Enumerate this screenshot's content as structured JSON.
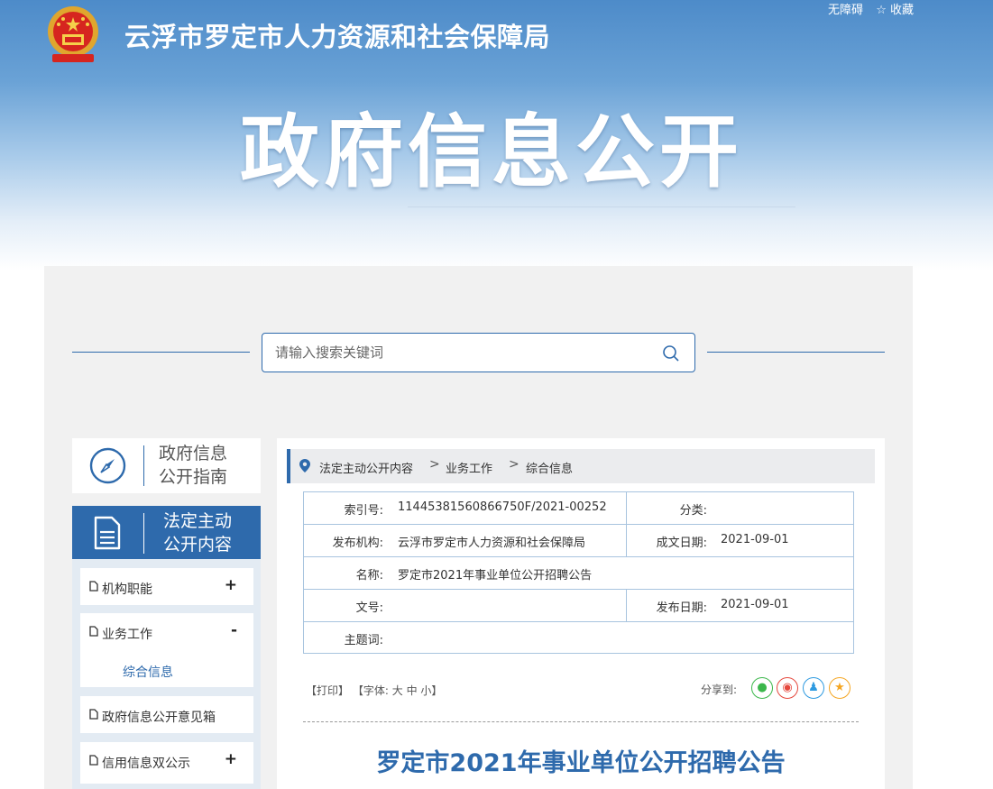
{
  "site": {
    "name": "云浮市罗定市人力资源和社会保障局",
    "top_links": [
      "无障碍",
      "☆ 收藏"
    ],
    "banner_title": "政府信息公开"
  },
  "search": {
    "placeholder": "请输入搜索关键词"
  },
  "sidebar": {
    "guide": {
      "line1": "政府信息",
      "line2": "公开指南"
    },
    "active": {
      "line1": "法定主动",
      "line2": "公开内容"
    },
    "items": [
      {
        "label": "机构职能",
        "toggle": "+"
      },
      {
        "label": "业务工作",
        "toggle": "-",
        "sub": "综合信息"
      },
      {
        "label": "政府信息公开意见箱",
        "toggle": ""
      },
      {
        "label": "信用信息双公示",
        "toggle": "+"
      }
    ]
  },
  "breadcrumb": [
    "法定主动公开内容",
    "业务工作",
    "综合信息"
  ],
  "breadcrumb_sep": ">",
  "info": {
    "index_label": "索引号:",
    "index_value": "11445381560866750F/2021-00252",
    "category_label": "分类:",
    "category_value": "",
    "publisher_label": "发布机构:",
    "publisher_value": "云浮市罗定市人力资源和社会保障局",
    "created_label": "成文日期:",
    "created_value": "2021-09-01",
    "name_label": "名称:",
    "name_value": "罗定市2021年事业单位公开招聘公告",
    "doc_label": "文号:",
    "doc_value": "",
    "published_label": "发布日期:",
    "published_value": "2021-09-01",
    "subject_label": "主题词:",
    "subject_value": ""
  },
  "tools": {
    "print": "【打印】",
    "font_open": "【字体:",
    "big": "大",
    "mid": "中",
    "small": "小",
    "font_close": "】"
  },
  "share": {
    "label": "分享到:",
    "buttons": [
      {
        "name": "wechat-share-icon",
        "glyph": "●",
        "color": "#3bb74b"
      },
      {
        "name": "weibo-share-icon",
        "glyph": "◉",
        "color": "#e5483d"
      },
      {
        "name": "qq-share-icon",
        "glyph": "♟",
        "color": "#2e9ae0"
      },
      {
        "name": "qzone-share-icon",
        "glyph": "★",
        "color": "#f5a623"
      }
    ]
  },
  "article": {
    "title": "罗定市2021年事业单位公开招聘公告"
  },
  "colors": {
    "brand": "#2e6aac"
  }
}
